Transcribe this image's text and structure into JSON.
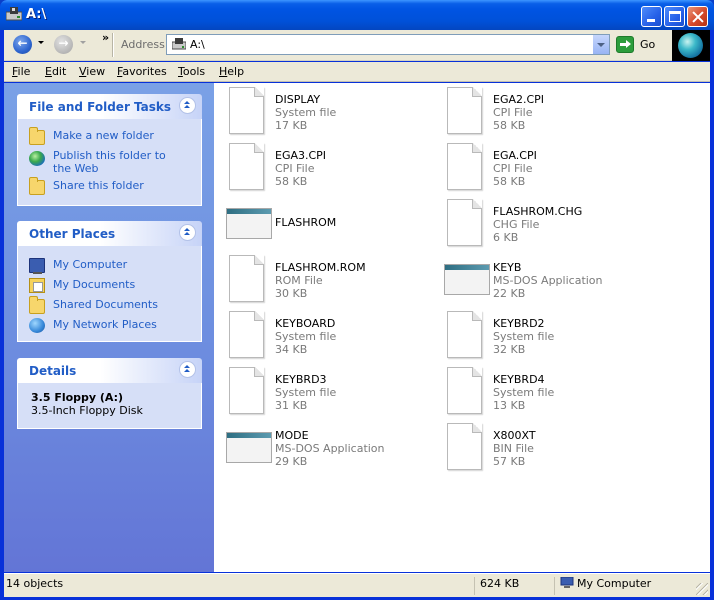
{
  "window": {
    "title": "A:\\",
    "buttons": [
      "minimize",
      "maximize",
      "close"
    ],
    "icon": "floppy-drive-icon"
  },
  "toolbar": {
    "back_label": "Back",
    "chevron": "»",
    "address_label": "Address",
    "address_value": "A:\\",
    "go_label": "Go"
  },
  "menu": [
    {
      "label": "File",
      "u": "F",
      "rest": "ile"
    },
    {
      "label": "Edit",
      "u": "E",
      "rest": "dit"
    },
    {
      "label": "View",
      "u": "V",
      "rest": "iew"
    },
    {
      "label": "Favorites",
      "u": "F",
      "rest": "avorites"
    },
    {
      "label": "Tools",
      "u": "T",
      "rest": "ools"
    },
    {
      "label": "Help",
      "u": "H",
      "rest": "elp"
    }
  ],
  "taskpane": {
    "file_tasks": {
      "title": "File and Folder Tasks",
      "items": [
        "Make a new folder",
        "Publish this folder to the Web",
        "Share this folder"
      ]
    },
    "other_places": {
      "title": "Other Places",
      "items": [
        "My Computer",
        "My Documents",
        "Shared Documents",
        "My Network Places"
      ]
    },
    "details": {
      "title": "Details",
      "name": "3.5 Floppy (A:)",
      "description": "3.5-Inch Floppy Disk"
    }
  },
  "files": [
    {
      "name": "DISPLAY",
      "type": "System file",
      "size": "17 KB",
      "icon": "file"
    },
    {
      "name": "EGA2.CPI",
      "type": "CPI File",
      "size": "58 KB",
      "icon": "file"
    },
    {
      "name": "EGA3.CPI",
      "type": "CPI File",
      "size": "58 KB",
      "icon": "file"
    },
    {
      "name": "EGA.CPI",
      "type": "CPI File",
      "size": "58 KB",
      "icon": "file"
    },
    {
      "name": "FLASHROM",
      "type": "",
      "size": "",
      "icon": "app"
    },
    {
      "name": "FLASHROM.CHG",
      "type": "CHG File",
      "size": "6 KB",
      "icon": "file"
    },
    {
      "name": "FLASHROM.ROM",
      "type": "ROM File",
      "size": "30 KB",
      "icon": "file"
    },
    {
      "name": "KEYB",
      "type": "MS-DOS Application",
      "size": "22 KB",
      "icon": "app"
    },
    {
      "name": "KEYBOARD",
      "type": "System file",
      "size": "34 KB",
      "icon": "file"
    },
    {
      "name": "KEYBRD2",
      "type": "System file",
      "size": "32 KB",
      "icon": "file"
    },
    {
      "name": "KEYBRD3",
      "type": "System file",
      "size": "31 KB",
      "icon": "file"
    },
    {
      "name": "KEYBRD4",
      "type": "System file",
      "size": "13 KB",
      "icon": "file"
    },
    {
      "name": "MODE",
      "type": "MS-DOS Application",
      "size": "29 KB",
      "icon": "app"
    },
    {
      "name": "X800XT",
      "type": "BIN File",
      "size": "57 KB",
      "icon": "file"
    }
  ],
  "status": {
    "objects": "14 objects",
    "size": "624 KB",
    "location": "My Computer"
  },
  "colors": {
    "titlebar": "#0054e3",
    "taskpane_bg": "#6e8fe0",
    "link": "#215dc6",
    "chrome": "#ece9d8"
  }
}
